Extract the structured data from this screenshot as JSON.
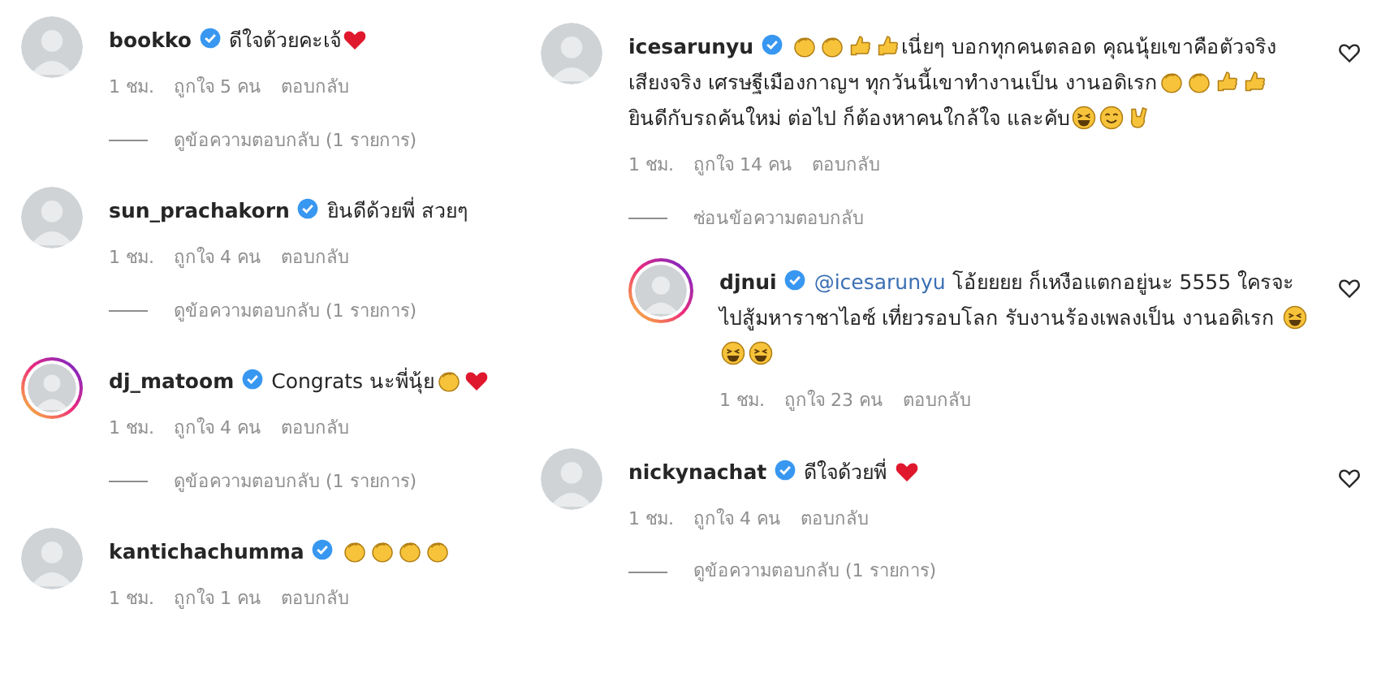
{
  "columns": [
    {
      "comments": [
        {
          "username": "bookko",
          "verified": true,
          "body": [
            {
              "kind": "text",
              "text": "ดีใจด้วยคะเจ้"
            },
            {
              "kind": "heart"
            }
          ],
          "time": "1 ชม.",
          "likes": "ถูกใจ 5 คน",
          "reply": "ตอบกลับ",
          "replies_toggle": "ดูข้อความตอบกลับ (1 รายการ)"
        },
        {
          "username": "sun_prachakorn",
          "verified": true,
          "body": [
            {
              "kind": "text",
              "text": "ยินดีด้วยพี่ สวยๆ"
            }
          ],
          "time": "1 ชม.",
          "likes": "ถูกใจ 4 คน",
          "reply": "ตอบกลับ",
          "replies_toggle": "ดูข้อความตอบกลับ (1 รายการ)"
        },
        {
          "username": "dj_matoom",
          "verified": true,
          "story_ring": true,
          "body": [
            {
              "kind": "text",
              "text": "Congrats นะพี่นุ้ย"
            },
            {
              "kind": "clap"
            },
            {
              "kind": "heart"
            }
          ],
          "time": "1 ชม.",
          "likes": "ถูกใจ 4 คน",
          "reply": "ตอบกลับ",
          "replies_toggle": "ดูข้อความตอบกลับ (1 รายการ)"
        },
        {
          "username": "kantichachumma",
          "verified": true,
          "body": [
            {
              "kind": "clap"
            },
            {
              "kind": "clap"
            },
            {
              "kind": "clap"
            },
            {
              "kind": "clap"
            }
          ],
          "time": "1 ชม.",
          "likes": "ถูกใจ 1 คน",
          "reply": "ตอบกลับ"
        }
      ]
    },
    {
      "comments": [
        {
          "username": "icesarunyu",
          "verified": true,
          "like_icon": true,
          "body": [
            {
              "kind": "clap"
            },
            {
              "kind": "clap"
            },
            {
              "kind": "thumb"
            },
            {
              "kind": "thumb"
            },
            {
              "kind": "text",
              "text": "เนี่ยๆ บอกทุกคนตลอด คุณนุ้ยเขาคือตัวจริงเสียงจริง เศรษฐีเมืองกาญฯ ทุกวันนี้เขาทำงานเป็น งานอดิเรก"
            },
            {
              "kind": "clap"
            },
            {
              "kind": "clap"
            },
            {
              "kind": "thumb"
            },
            {
              "kind": "thumb"
            },
            {
              "kind": "text",
              "text": " ยินดีกับรถคันใหม่ ต่อไป ก็ต้องหาคนใกล้ใจ และคับ"
            },
            {
              "kind": "grin"
            },
            {
              "kind": "hug"
            },
            {
              "kind": "horns"
            }
          ],
          "time": "1 ชม.",
          "likes": "ถูกใจ 14 คน",
          "reply": "ตอบกลับ",
          "replies_toggle": "ซ่อนข้อความตอบกลับ",
          "replies": [
            {
              "username": "djnui",
              "verified": true,
              "story_ring": true,
              "like_icon": true,
              "body": [
                {
                  "kind": "mention",
                  "text": "@icesarunyu"
                },
                {
                  "kind": "text",
                  "text": " โอ้ยยยย ก็เหงือแตกอยู่นะ 5555 ใครจะไปสู้มหาราชาไอซ์ เที่ยวรอบโลก รับงานร้องเพลงเป็น งานอดิเรก "
                },
                {
                  "kind": "laugh"
                },
                {
                  "kind": "laugh"
                },
                {
                  "kind": "laugh"
                }
              ],
              "time": "1 ชม.",
              "likes": "ถูกใจ 23 คน",
              "reply": "ตอบกลับ"
            }
          ]
        },
        {
          "username": "nickynachat",
          "verified": true,
          "like_icon": true,
          "body": [
            {
              "kind": "text",
              "text": "ดีใจด้วยพี่ "
            },
            {
              "kind": "heart"
            }
          ],
          "time": "1 ชม.",
          "likes": "ถูกใจ 4 คน",
          "reply": "ตอบกลับ",
          "replies_toggle": "ดูข้อความตอบกลับ (1 รายการ)"
        }
      ]
    }
  ]
}
